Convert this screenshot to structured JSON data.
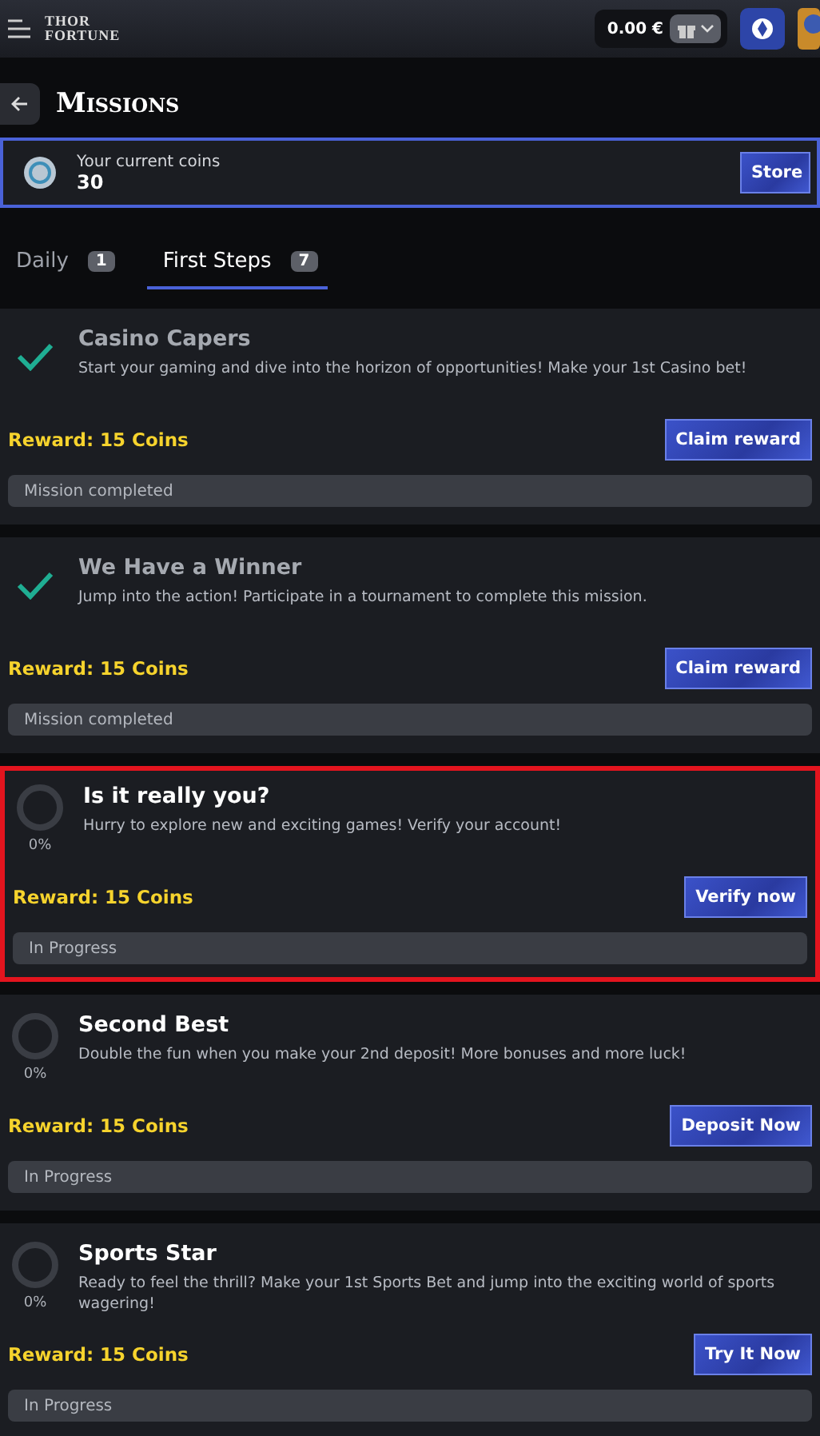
{
  "header": {
    "logo": [
      "THOR",
      "FORTUNE"
    ],
    "balance": "0.00 €"
  },
  "page": {
    "title": "Missions"
  },
  "coins": {
    "label": "Your current coins",
    "value": "30",
    "button": "Store"
  },
  "tabs": [
    {
      "label": "Daily",
      "count": "1",
      "selected": false
    },
    {
      "label": "First Steps",
      "count": "7",
      "selected": true
    }
  ],
  "missions": [
    {
      "kind": "completed",
      "title": "Casino Capers",
      "description": "Start your gaming and dive into the horizon of opportunities! Make your 1st Casino bet!",
      "reward": "Reward: 15 Coins",
      "button": "Claim reward",
      "status": "Mission completed",
      "highlighted": false
    },
    {
      "kind": "completed",
      "title": "We Have a Winner",
      "description": "Jump into the action! Participate in a tournament to complete this mission.",
      "reward": "Reward: 15 Coins",
      "button": "Claim reward",
      "status": "Mission completed",
      "highlighted": false
    },
    {
      "kind": "progress",
      "title": "Is it really you?",
      "description": "Hurry to explore new and exciting games! Verify your account!",
      "progress": "0%",
      "reward": "Reward: 15 Coins",
      "button": "Verify now",
      "status": "In Progress",
      "highlighted": true
    },
    {
      "kind": "progress",
      "title": "Second Best",
      "description": "Double the fun when you make your 2nd deposit! More bonuses and more luck!",
      "progress": "0%",
      "reward": "Reward: 15 Coins",
      "button": "Deposit Now",
      "status": "In Progress",
      "highlighted": false
    },
    {
      "kind": "progress",
      "title": "Sports Star",
      "description": "Ready to feel the thrill? Make your 1st Sports Bet and jump into the exciting world of sports wagering!",
      "progress": "0%",
      "reward": "Reward: 15 Coins",
      "button": "Try It Now",
      "status": "In Progress",
      "highlighted": false
    }
  ]
}
